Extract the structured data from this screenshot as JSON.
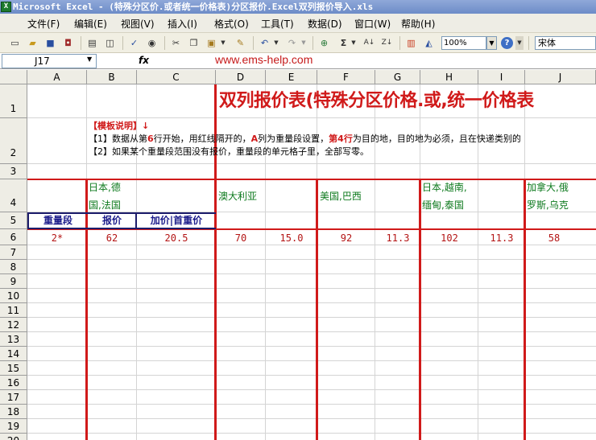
{
  "window": {
    "title": "Microsoft Excel - (特殊分区价.或者统一价格表)分区报价.Excel双列报价导入.xls",
    "app_icon": "excel-icon"
  },
  "menu": [
    {
      "label": "文件(F)"
    },
    {
      "label": "编辑(E)"
    },
    {
      "label": "视图(V)"
    },
    {
      "label": "插入(I)"
    },
    {
      "label": "格式(O)"
    },
    {
      "label": "工具(T)"
    },
    {
      "label": "数据(D)"
    },
    {
      "label": "窗口(W)"
    },
    {
      "label": "帮助(H)"
    }
  ],
  "toolbar": {
    "zoom": "100%",
    "font": "宋体"
  },
  "formula_bar": {
    "name_box": "J17",
    "fx_label": "fx",
    "content": ""
  },
  "watermark": "www.ems-help.com",
  "columns": [
    "A",
    "B",
    "C",
    "D",
    "E",
    "F",
    "G",
    "H",
    "I",
    "J"
  ],
  "rows": [
    "1",
    "2",
    "3",
    "4",
    "5",
    "6",
    "7",
    "8",
    "9",
    "10",
    "11",
    "12",
    "13",
    "14",
    "15",
    "16",
    "17",
    "18",
    "19",
    "20"
  ],
  "sheet": {
    "title": "双列报价表(特殊分区价格.或,统一价格表",
    "instructions": {
      "head": "【模板说明】↓",
      "line1_parts": [
        "【1】数据从第",
        "6",
        "行开始，用红线隔开的，",
        "A",
        "列为重量段设置，",
        "第4行",
        "为目的地，目的地为必须，且在快递类别的"
      ],
      "line2": "【2】如果某个重量段范围没有报价，重量段的单元格子里，全部写零。"
    },
    "groups": [
      {
        "col": "B",
        "line1": "日本,德",
        "line2": "国,法国"
      },
      {
        "col": "D",
        "line1": "澳大利亚",
        "line2": ""
      },
      {
        "col": "F",
        "line1": "美国,巴西",
        "line2": ""
      },
      {
        "col": "H",
        "line1": "日本,越南,",
        "line2": "缅甸,泰国"
      },
      {
        "col": "J",
        "line1": "加拿大,俄",
        "line2": "罗斯,乌克"
      }
    ],
    "row5_headers": {
      "a": "重量段",
      "b": "报价",
      "c": "加价|首重价"
    },
    "row6": {
      "A": "2*",
      "B": "62",
      "C": "20.5",
      "D": "70",
      "E": "15.0",
      "F": "92",
      "G": "11.3",
      "H": "102",
      "I": "11.3",
      "J": "58"
    }
  }
}
